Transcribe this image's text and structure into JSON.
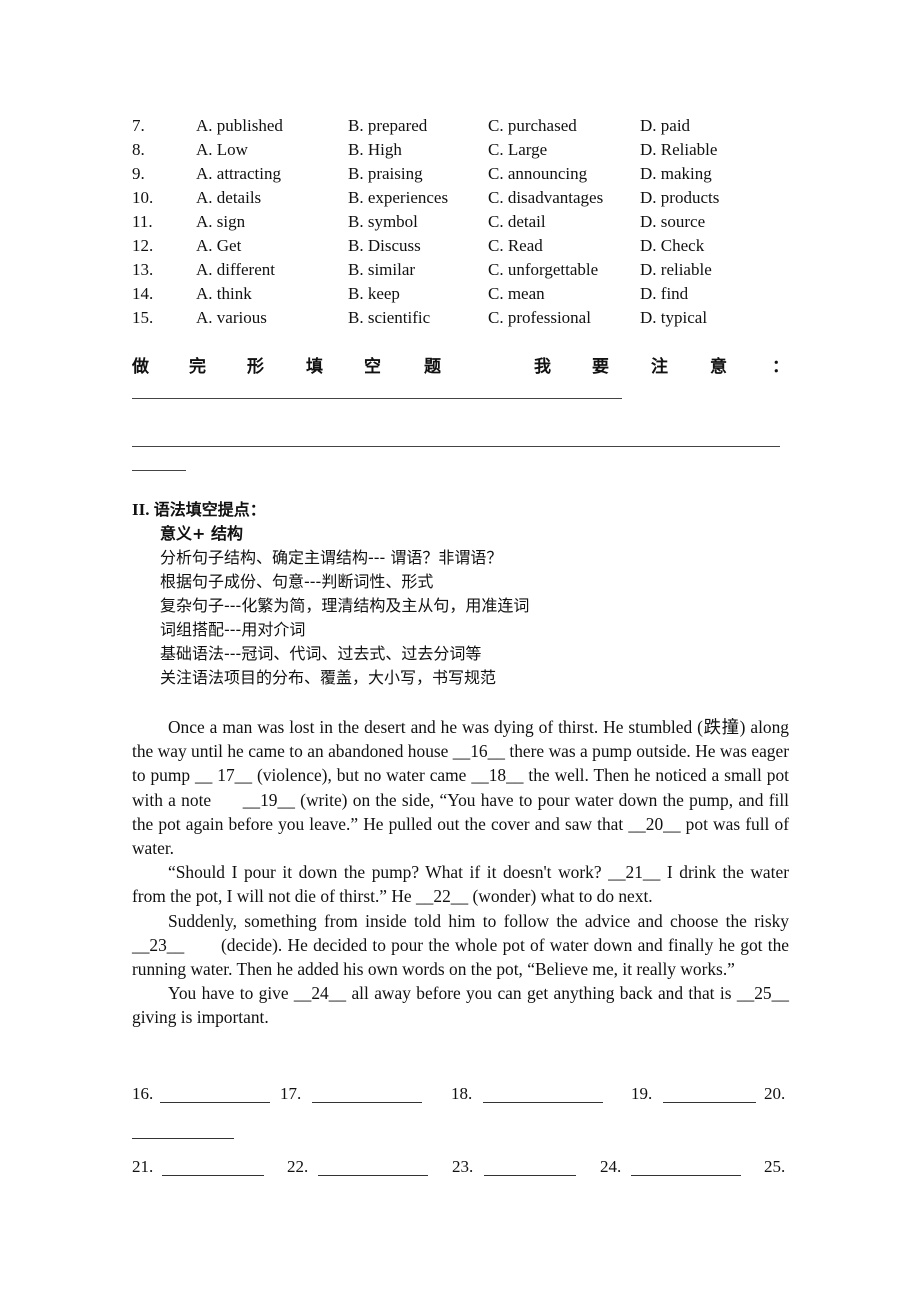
{
  "options": [
    {
      "num": "7.",
      "a": "A. published",
      "b": "B. prepared",
      "c": "C. purchased",
      "d": "D. paid"
    },
    {
      "num": "8.",
      "a": "A. Low",
      "b": "B. High",
      "c": "C. Large",
      "d": "D. Reliable"
    },
    {
      "num": "9.",
      "a": "A. attracting",
      "b": "B. praising",
      "c": "C. announcing",
      "d": "D. making"
    },
    {
      "num": "10.",
      "a": "A. details",
      "b": "B. experiences",
      "c": "C. disadvantages",
      "d": "D. products"
    },
    {
      "num": "11.",
      "a": "A. sign",
      "b": "B. symbol",
      "c": "C. detail",
      "d": "D. source"
    },
    {
      "num": "12.",
      "a": "A. Get",
      "b": "B. Discuss",
      "c": "C. Read",
      "d": "D. Check"
    },
    {
      "num": "13.",
      "a": "A. different",
      "b": "B. similar",
      "c": "C. unforgettable",
      "d": "D. reliable"
    },
    {
      "num": "14.",
      "a": "A. think",
      "b": "B. keep",
      "c": "C. mean",
      "d": "D. find"
    },
    {
      "num": "15.",
      "a": "A. various",
      "b": "B. scientific",
      "c": "C. professional",
      "d": "D. typical"
    }
  ],
  "notes": {
    "chars": [
      "做",
      "完",
      "形",
      "填",
      "空",
      "题",
      "我",
      "要",
      "注",
      "意",
      "："
    ]
  },
  "section2": {
    "numeral": "II.",
    "title": "语法填空提点：",
    "subtitle": "意义+ 结构",
    "tips": [
      "分析句子结构、确定主谓结构--- 谓语？非谓语？",
      "根据句子成份、句意---判断词性、形式",
      "复杂句子---化繁为简，理清结构及主从句，用准连词",
      "词组搭配---用对介词",
      "基础语法---冠词、代词、过去式、过去分词等",
      "关注语法项目的分布、覆盖，大小写，书写规范"
    ]
  },
  "passage": {
    "paragraphs": [
      "Once a man was lost in the desert and he was dying of thirst. He stumbled (跌撞) along the way until he came to an abandoned house __16__ there was a pump outside. He was eager to pump __ 17__ (violence), but no water came __18__ the well. Then he noticed a small pot with a note      __19__ (write) on the side, “You have to pour water down the pump, and fill the pot again before you leave.” He pulled out the cover and saw that __20__ pot was full of water.",
      "“Should I pour it down the pump? What if it doesn't work? __21__ I drink the water from the pot, I will not die of thirst.” He __22__ (wonder) what to do next.",
      "Suddenly, something from inside told him to follow the advice and choose the risky __23__       (decide). He decided to pour the whole pot of water down and finally he got the running water. Then he added his own words on the pot, “Believe me, it really works.”",
      "You have to give __24__ all away before you can get anything back and that is __25__ giving is important."
    ]
  },
  "answers": {
    "row1": [
      "16.",
      "17.",
      "18.",
      "19.",
      "20."
    ],
    "row2": [
      "21.",
      "22.",
      "23.",
      "24.",
      "25."
    ]
  }
}
